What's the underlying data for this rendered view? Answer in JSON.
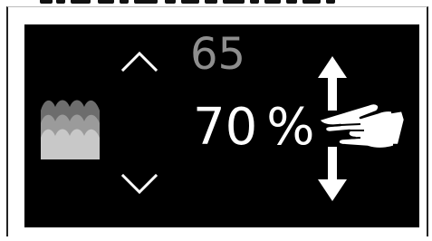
{
  "display": {
    "previous_value": "65",
    "current_value": "70",
    "unit": "%"
  },
  "icons": {
    "increase": "chevron-up-icon",
    "decrease": "chevron-down-icon",
    "setting": "fog-layers-icon",
    "gesture": "swipe-up-down-hand-icon"
  },
  "colors": {
    "screen_background": "#000000",
    "current_value": "#ffffff",
    "previous_value": "#8e8e8e",
    "icon_layer_dark": "#6d6d6d",
    "icon_layer_mid": "#9b9b9b",
    "icon_layer_light": "#c8c8c8"
  }
}
